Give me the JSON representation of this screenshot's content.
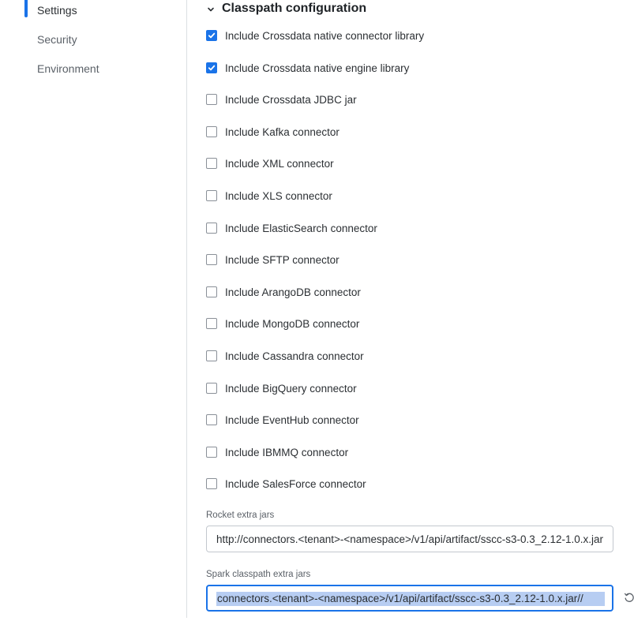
{
  "sidebar": {
    "items": [
      {
        "label": "Settings",
        "active": true
      },
      {
        "label": "Security",
        "active": false
      },
      {
        "label": "Environment",
        "active": false
      }
    ]
  },
  "section": {
    "title": "Classpath configuration",
    "checkboxes": [
      {
        "label": "Include Crossdata native connector library",
        "checked": true
      },
      {
        "label": "Include Crossdata native engine library",
        "checked": true
      },
      {
        "label": "Include Crossdata JDBC jar",
        "checked": false
      },
      {
        "label": "Include Kafka connector",
        "checked": false
      },
      {
        "label": "Include XML connector",
        "checked": false
      },
      {
        "label": "Include XLS connector",
        "checked": false
      },
      {
        "label": "Include ElasticSearch connector",
        "checked": false
      },
      {
        "label": "Include SFTP connector",
        "checked": false
      },
      {
        "label": "Include ArangoDB connector",
        "checked": false
      },
      {
        "label": "Include MongoDB connector",
        "checked": false
      },
      {
        "label": "Include Cassandra connector",
        "checked": false
      },
      {
        "label": "Include BigQuery connector",
        "checked": false
      },
      {
        "label": "Include EventHub connector",
        "checked": false
      },
      {
        "label": "Include IBMMQ connector",
        "checked": false
      },
      {
        "label": "Include SalesForce connector",
        "checked": false
      }
    ]
  },
  "fields": {
    "rocket_extra_jars": {
      "label": "Rocket extra jars",
      "value": "http://connectors.<tenant>-<namespace>/v1/api/artifact/sscc-s3-0.3_2.12-1.0.x.jar"
    },
    "spark_classpath_extra_jars": {
      "label": "Spark classpath extra jars",
      "value": "//connectors.<tenant>-<namespace>/v1/api/artifact/sscc-s3-0.3_2.12-1.0.x.jar"
    }
  },
  "colors": {
    "accent": "#1a73e8",
    "selection": "#b7cdf2"
  }
}
